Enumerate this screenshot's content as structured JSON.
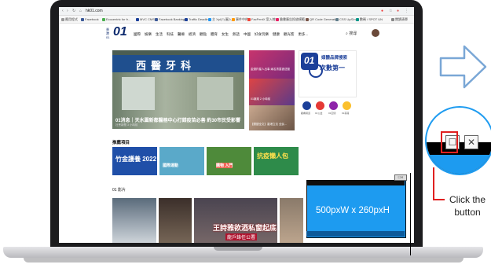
{
  "browser": {
    "url": "hk01.com",
    "bookmarks": [
      "應用程式",
      "Facebook",
      "Ecocentric for fr...",
      "MVC CMS",
      "Facebook Banking",
      "Traffic Deadlinc",
      "主 Xpl(?) 圖入",
      "事件中的",
      "FacPentX 案入線",
      "臉書廣告投放模範",
      "QR Code Generator",
      "CSS Up/Dn",
      "數碼 / SPOT UN",
      "閱讀清單"
    ]
  },
  "site": {
    "logo_small": "香港01",
    "logo_main": "01",
    "nav": [
      "國際",
      "娛樂",
      "生活",
      "科技",
      "醫療",
      "經濟",
      "觀點",
      "體育",
      "女生",
      "熱話",
      "中國",
      "好食玩樂",
      "健康",
      "觀光客",
      "更多..."
    ],
    "search_label": "搜尋"
  },
  "hero": {
    "sign_text": "西醫牙科",
    "caption": "01消息｜天水圍新都醫務中心打錯疫苗必善  約30市民受影響",
    "sub": "社會新聞 3 小時前"
  },
  "side_news": [
    {
      "text": "金翅羚星人出事 兩名男童被送醫"
    },
    {
      "text": "01娛樂 2 小時前"
    },
    {
      "text": "【閱讀全文】香港立法 全民..."
    }
  ],
  "ad": {
    "brand": "01",
    "line1": "媒體品牌搜索",
    "line2": "次數第一"
  },
  "quick_links": [
    "觀看報道",
    "01公益",
    "01空間",
    "01哥哥"
  ],
  "recommended": {
    "title": "推薦項目",
    "items": [
      "竹金護養 2022",
      "國際運動",
      "購物 入門",
      "抗疫懶人包"
    ]
  },
  "videos": {
    "title": "01 影片",
    "main_caption": "王詩雅欲酒私窗起底",
    "sub_caption": "龍戶錄任公署"
  },
  "overlay": {
    "size_text": "500pxW x 260pxH"
  },
  "callout": {
    "label": "Click the button",
    "colors": {
      "accent": "#e02020",
      "overlay": "#1d9bf0"
    }
  }
}
